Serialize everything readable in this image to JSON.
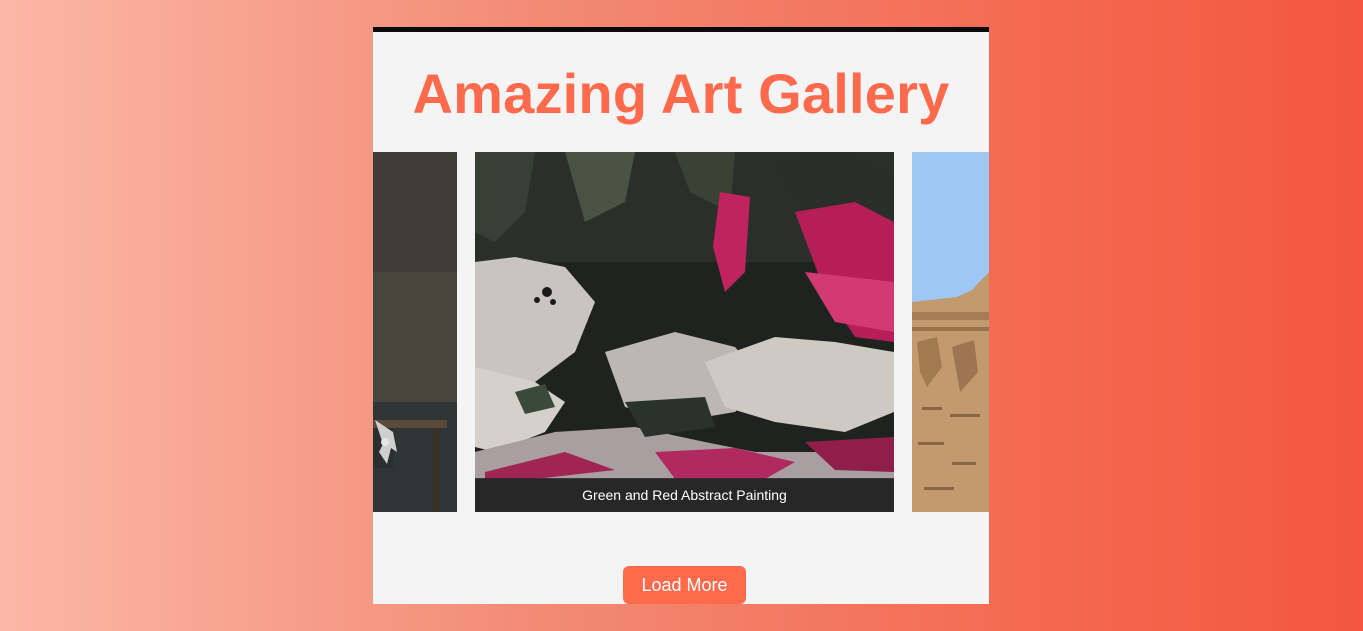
{
  "gallery": {
    "title": "Amazing Art Gallery",
    "slides": [
      {
        "image": "dark-interior-photo",
        "caption": ""
      },
      {
        "image": "abstract-painting-photo",
        "caption": "Green and Red Abstract Painting"
      },
      {
        "image": "egyptian-temple-photo",
        "caption": ""
      }
    ],
    "load_more_label": "Load More"
  },
  "colors": {
    "accent": "#ff6a4d",
    "card_background": "#f4f4f4",
    "card_top_border": "#0a0a0a",
    "page_gradient_start": "#fcb7a6",
    "page_gradient_end": "#f4563f"
  }
}
